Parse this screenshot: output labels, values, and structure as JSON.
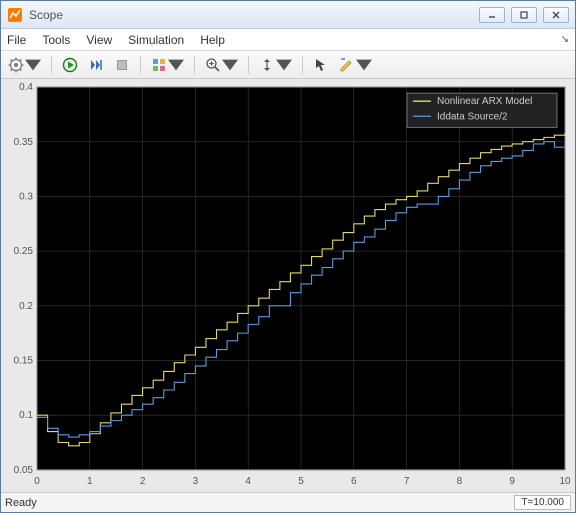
{
  "window": {
    "title": "Scope"
  },
  "menu": {
    "file": "File",
    "tools": "Tools",
    "view": "View",
    "simulation": "Simulation",
    "help": "Help"
  },
  "status": {
    "ready": "Ready",
    "time": "T=10.000"
  },
  "icons": {
    "settings": "settings-gear-icon",
    "run": "run-icon",
    "step_fwd": "step-forward-icon",
    "stop": "stop-icon",
    "highlight": "highlight-icon",
    "zoom": "zoom-icon",
    "pan": "scale-axes-icon",
    "cursor": "cursor-measure-icon",
    "annotate": "annotate-icon"
  },
  "chart_data": {
    "type": "line",
    "title": "",
    "xlabel": "",
    "ylabel": "",
    "xlim": [
      0,
      10
    ],
    "ylim": [
      0.05,
      0.4
    ],
    "xticks": [
      0,
      1,
      2,
      3,
      4,
      5,
      6,
      7,
      8,
      9,
      10
    ],
    "yticks": [
      0.05,
      0.1,
      0.15,
      0.2,
      0.25,
      0.3,
      0.35,
      0.4
    ],
    "legend": {
      "position": "upper-right",
      "entries": [
        "Nonlinear ARX Model",
        "Iddata Source/2"
      ]
    },
    "colors": {
      "bg": "#000000",
      "grid": "#3a3a3a",
      "axis_text": "#aaaaaa",
      "series1": "#e6d960",
      "series2": "#5a9de0",
      "legend_box": "#222222",
      "legend_border": "#888888",
      "legend_text": "#cccccc"
    },
    "x": [
      0,
      0.2,
      0.4,
      0.6,
      0.8,
      1,
      1.2,
      1.4,
      1.6,
      1.8,
      2,
      2.2,
      2.4,
      2.6,
      2.8,
      3,
      3.2,
      3.4,
      3.6,
      3.8,
      4,
      4.2,
      4.4,
      4.6,
      4.8,
      5,
      5.2,
      5.4,
      5.6,
      5.8,
      6,
      6.2,
      6.4,
      6.6,
      6.8,
      7,
      7.2,
      7.4,
      7.6,
      7.8,
      8,
      8.2,
      8.4,
      8.6,
      8.8,
      9,
      9.2,
      9.4,
      9.6,
      9.8,
      10
    ],
    "series": [
      {
        "name": "Nonlinear ARX Model",
        "values": [
          0.1,
          0.085,
          0.075,
          0.072,
          0.075,
          0.083,
          0.093,
          0.102,
          0.11,
          0.118,
          0.125,
          0.132,
          0.14,
          0.148,
          0.155,
          0.162,
          0.17,
          0.178,
          0.185,
          0.193,
          0.2,
          0.207,
          0.215,
          0.222,
          0.23,
          0.237,
          0.245,
          0.252,
          0.26,
          0.267,
          0.275,
          0.282,
          0.288,
          0.293,
          0.297,
          0.3,
          0.305,
          0.312,
          0.318,
          0.324,
          0.33,
          0.335,
          0.34,
          0.343,
          0.346,
          0.348,
          0.35,
          0.352,
          0.354,
          0.356,
          0.358
        ]
      },
      {
        "name": "Iddata Source/2",
        "values": [
          0.098,
          0.088,
          0.082,
          0.08,
          0.082,
          0.085,
          0.09,
          0.095,
          0.1,
          0.105,
          0.11,
          0.116,
          0.123,
          0.13,
          0.138,
          0.145,
          0.153,
          0.16,
          0.168,
          0.175,
          0.183,
          0.19,
          0.2,
          0.2,
          0.212,
          0.22,
          0.228,
          0.235,
          0.243,
          0.25,
          0.258,
          0.263,
          0.27,
          0.278,
          0.285,
          0.29,
          0.293,
          0.293,
          0.3,
          0.307,
          0.315,
          0.322,
          0.328,
          0.332,
          0.335,
          0.337,
          0.342,
          0.348,
          0.35,
          0.345,
          0.352
        ]
      }
    ]
  }
}
